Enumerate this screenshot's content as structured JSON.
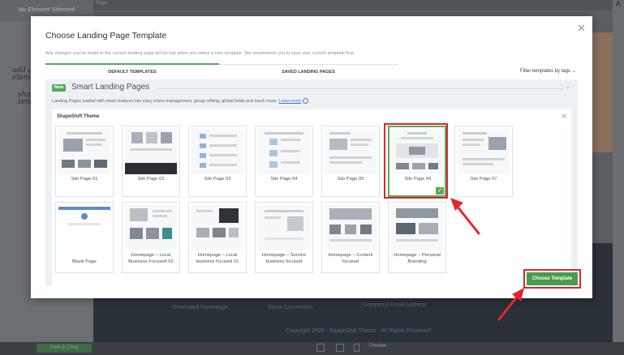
{
  "background": {
    "left_panel_title": "No Element Selected",
    "scribble_1": [
      "add a",
      "eleme"
    ],
    "scribble_2": [
      "shape",
      "templ"
    ],
    "canvas_tab": "Page",
    "footer_left": "Generated Homepage",
    "footer_mid": "Boost Conversion",
    "footer_right": "[Company] Email Address",
    "footer_copyright": "Copyright 2020 · ShapeShift Theme · All Rights Reserved",
    "bottom_button": "Save & Close",
    "preview_label": "Preview",
    "right_rail_letter": "A"
  },
  "modal": {
    "title": "Choose Landing Page Template",
    "note": "Any changes you've made to the current landing page will be lost when you select a new template. We recommend you to save your current template first.",
    "tabs": [
      {
        "label": "DEFAULT TEMPLATES",
        "active": true
      },
      {
        "label": "SAVED LANDING PAGES",
        "active": false
      }
    ],
    "filter_label": "Filter templates by tags",
    "section": {
      "badge": "New",
      "title": "Smart Landing Pages",
      "description": "Landing Pages loaded with smart features like easy colors management, group editing, global fields and much more.",
      "learn_more": "Learn more",
      "theme_title": "ShapeShift Theme"
    },
    "templates": [
      {
        "name": "Silo Page 01"
      },
      {
        "name": "Silo Page 02"
      },
      {
        "name": "Silo Page 03"
      },
      {
        "name": "Silo Page 04"
      },
      {
        "name": "Silo Page 05"
      },
      {
        "name": "Silo Page 06",
        "selected": true
      },
      {
        "name": "Silo Page 07"
      },
      {
        "name": "Blank Page"
      },
      {
        "name": "Homepage – Local Business Focused 02"
      },
      {
        "name": "Homepage – Local business focused 01"
      },
      {
        "name": "Homepage – Service business focused"
      },
      {
        "name": "Homepage – Content focused"
      },
      {
        "name": "Homepage – Personal Branding"
      }
    ],
    "choose_button": "Choose Template"
  },
  "colors": {
    "accent_green": "#5aa95f",
    "button_green": "#4a9a4f",
    "highlight_red": "#d9272e",
    "link_blue": "#3b7bd4"
  },
  "icons": {
    "modal_close": "close-icon",
    "theme_close": "close-icon",
    "filter_caret": "chevron-down-icon",
    "selected_check": "check-icon",
    "info": "info-icon"
  }
}
